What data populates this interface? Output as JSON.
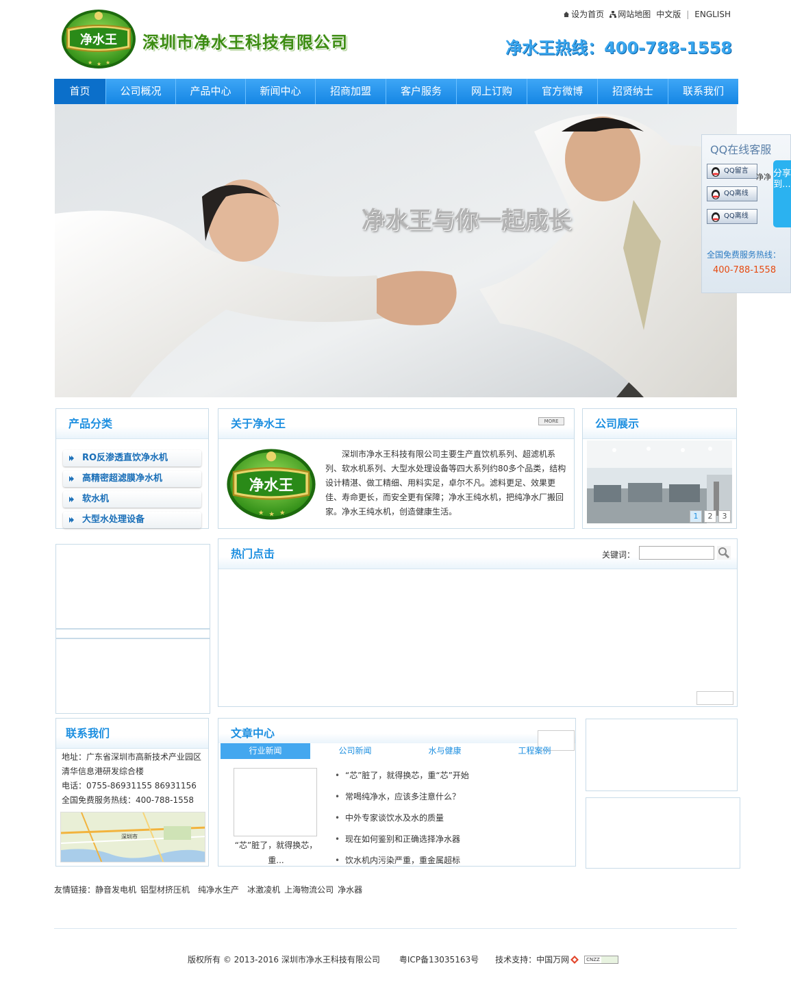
{
  "header": {
    "company_name": "深圳市净水王科技有限公司",
    "logo_text": "净水王",
    "top_links": [
      "设为首页",
      "网站地图",
      "中文版",
      "ENGLISH"
    ],
    "hotline": "净水王热线：400-788-1558"
  },
  "nav": {
    "items": [
      "首页",
      "公司概况",
      "产品中心",
      "新闻中心",
      "招商加盟",
      "客户服务",
      "网上订购",
      "官方微博",
      "招贤纳士",
      "联系我们"
    ],
    "active_index": 0
  },
  "banner": {
    "slogan": "净水王与你一起成长"
  },
  "qq_panel": {
    "title": "QQ在线客服",
    "buttons": [
      "QQ留言",
      "QQ离线",
      "QQ离线"
    ],
    "free_label": "全国免费服务热线：",
    "free_number": "400-788-1558",
    "side_text": "净净",
    "share_tab": "分享到..."
  },
  "products": {
    "title": "产品分类",
    "items": [
      "RO反渗透直饮净水机",
      "高精密超滤膜净水机",
      "软水机",
      "大型水处理设备"
    ]
  },
  "about": {
    "title": "关于净水王",
    "more": "MORE",
    "text": "深圳市净水王科技有限公司主要生产直饮机系列、超滤机系列、软水机系列、大型水处理设备等四大系列约80多个品类，结构设计精湛、做工精细、用料实足，卓尔不凡。滤料更足、效果更佳、寿命更长，而安全更有保障；净水王纯水机，把纯净水厂搬回家。净水王纯水机，创造健康生活。"
  },
  "showcase": {
    "title": "公司展示",
    "pages": [
      "1",
      "2",
      "3"
    ]
  },
  "hot": {
    "title": "热门点击",
    "keyword_label": "关键词：",
    "keyword_value": ""
  },
  "contact": {
    "title": "联系我们",
    "address": "地址：广东省深圳市高新技术产业园区清华信息港研发综合楼",
    "phone": "电话：0755-86931155 86931156",
    "free_line": "全国免费服务热线：400-788-1558",
    "map_label": "深圳市"
  },
  "articles": {
    "title": "文章中心",
    "tabs": [
      "行业新闻",
      "公司新闻",
      "水与健康",
      "工程案例"
    ],
    "active_tab": 0,
    "thumb_caption": "“芯”脏了，就得换芯，重...",
    "items": [
      "“芯”脏了，就得换芯，重“芯”开始",
      "常喝纯净水，应该多注意什么？",
      "中外专家谈饮水及水的质量",
      "现在如何鉴别和正确选择净水器",
      "饮水机内污染严重，重金属超标"
    ]
  },
  "friend_links": {
    "label": "友情链接：",
    "items": [
      "静音发电机",
      "铝型材挤压机",
      "纯净水生产",
      "冰激凌机",
      "上海物流公司",
      "净水器"
    ]
  },
  "footer": {
    "copyright": "版权所有 © 2013-2016 深圳市净水王科技有限公司",
    "icp": "粤ICP备13035163号",
    "support": "技术支持：中国万网",
    "badge": "CNZZ"
  },
  "colors": {
    "brand_green": "#3c8c12",
    "nav_blue": "#1586e4",
    "title_blue": "#1d8fe0",
    "hotline_orange": "#e64a10"
  }
}
